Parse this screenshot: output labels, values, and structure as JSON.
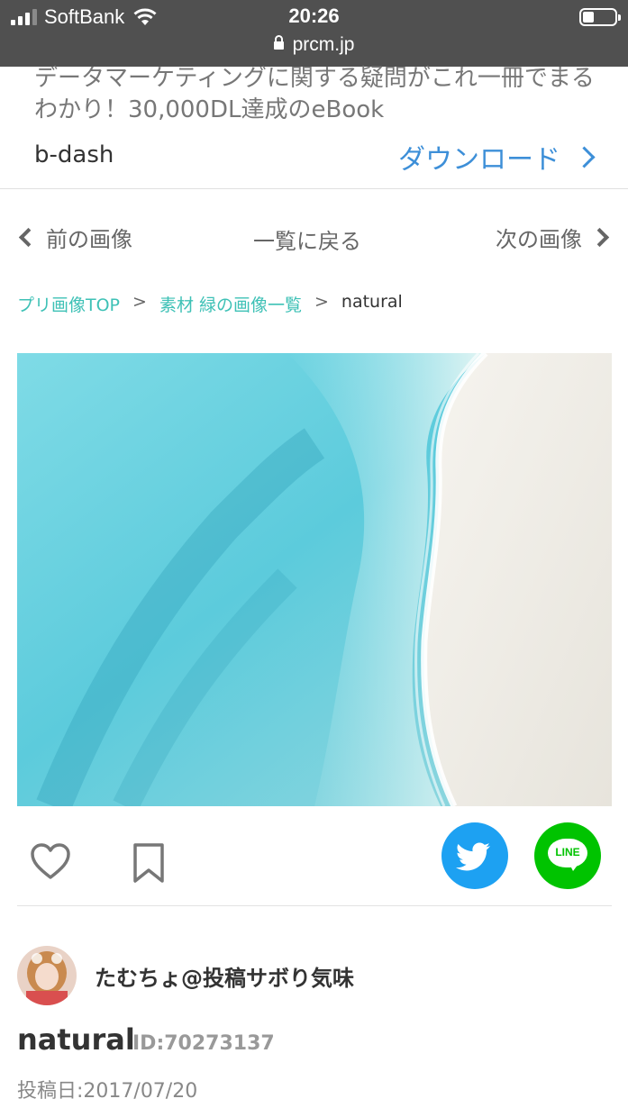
{
  "status_bar": {
    "carrier": "SoftBank",
    "time": "20:26",
    "url": "prcm.jp"
  },
  "ad": {
    "text": "データマーケティングに関する疑問がこれ一冊でまるわかり！30,000DL達成のeBook",
    "brand": "b-dash",
    "cta": "ダウンロード"
  },
  "nav": {
    "prev": "前の画像",
    "back": "一覧に戻る",
    "next": "次の画像"
  },
  "breadcrumb": {
    "items": [
      "プリ画像TOP",
      "素材 緑の画像一覧"
    ],
    "separator": ">",
    "current": "natural"
  },
  "share": {
    "line_label": "LINE",
    "twitter_color": "#1da1f2",
    "line_color": "#00c300"
  },
  "post": {
    "author": "たむちょ@投稿サボり気味",
    "title": "natural",
    "id": "ID:70273137",
    "posted": "投稿日:2017/07/20"
  },
  "colors": {
    "accent_link": "#3ec1b6",
    "cta_blue": "#3d8fd8"
  }
}
